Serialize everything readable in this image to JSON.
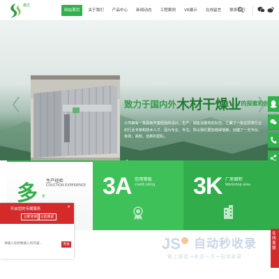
{
  "header": {
    "logo_text": "森达",
    "nav": [
      "网站首页",
      "关于我们",
      "产品中心",
      "新闻动态",
      "工程案例",
      "VR展示",
      "在线留言",
      "联系我们"
    ],
    "active_index": 0
  },
  "banner": {
    "headline_pre": "致力于国内外",
    "headline_big": "木材干燥业",
    "headline_post": "的探索和创新",
    "intro": "公司拥有一批具有丰富经验的设计、生产、销售及服务的队伍，汇聚了一批在同类行业的行业专家和技术人才，因为专业、专注，所以我们更加值得信赖，创建了一支专业、有效、高效、创新的团队。",
    "phone1": "4000-827-287",
    "phone2": "024-73653666"
  },
  "stats": [
    {
      "number": "多",
      "unit": "年",
      "title": "生产经验",
      "subtitle": "COUCTION EXPERIENCE"
    },
    {
      "number": "3A",
      "title": "信用等级",
      "subtitle": "credit rating"
    },
    {
      "number": "3K",
      "title": "厂房面积",
      "subtitle": "Workshop area"
    }
  ],
  "chat": {
    "title": "开启您的专属服务",
    "close": "×",
    "btn_consult": "立即咨询",
    "btn_later": "以后再说",
    "input_placeholder": "请输入您想要输入的内容...",
    "send": "发送"
  },
  "promo_tab": "在线客服",
  "watermark": {
    "title": "自动秒收录",
    "subtitle": "做上链接→来访一次→自动收录"
  },
  "colors": {
    "primary_green": "#30b24a",
    "dark_green": "#1f7a32",
    "chat_red": "#d42a2a"
  },
  "icons": {
    "side": [
      "qq-icon",
      "wechat-icon",
      "phone-icon",
      "share-icon"
    ],
    "header": [
      "search-icon",
      "wechat-icon",
      "weibo-icon"
    ]
  }
}
